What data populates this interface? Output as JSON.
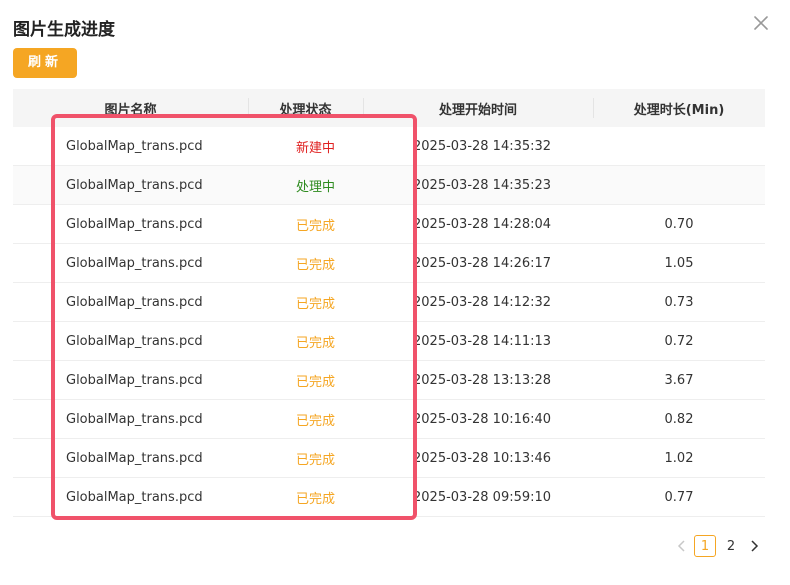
{
  "dialog": {
    "title": "图片生成进度",
    "refresh_label": "刷新"
  },
  "table": {
    "headers": [
      "图片名称",
      "处理状态",
      "处理开始时间",
      "处理时长(Min)"
    ],
    "rows": [
      {
        "name": "GlobalMap_trans.pcd",
        "status": "新建中",
        "start": "2025-03-28 14:35:32",
        "duration": ""
      },
      {
        "name": "GlobalMap_trans.pcd",
        "status": "处理中",
        "start": "2025-03-28 14:35:23",
        "duration": ""
      },
      {
        "name": "GlobalMap_trans.pcd",
        "status": "已完成",
        "start": "2025-03-28 14:28:04",
        "duration": "0.70"
      },
      {
        "name": "GlobalMap_trans.pcd",
        "status": "已完成",
        "start": "2025-03-28 14:26:17",
        "duration": "1.05"
      },
      {
        "name": "GlobalMap_trans.pcd",
        "status": "已完成",
        "start": "2025-03-28 14:12:32",
        "duration": "0.73"
      },
      {
        "name": "GlobalMap_trans.pcd",
        "status": "已完成",
        "start": "2025-03-28 14:11:13",
        "duration": "0.72"
      },
      {
        "name": "GlobalMap_trans.pcd",
        "status": "已完成",
        "start": "2025-03-28 13:13:28",
        "duration": "3.67"
      },
      {
        "name": "GlobalMap_trans.pcd",
        "status": "已完成",
        "start": "2025-03-28 10:16:40",
        "duration": "0.82"
      },
      {
        "name": "GlobalMap_trans.pcd",
        "status": "已完成",
        "start": "2025-03-28 10:13:46",
        "duration": "1.02"
      },
      {
        "name": "GlobalMap_trans.pcd",
        "status": "已完成",
        "start": "2025-03-28 09:59:10",
        "duration": "0.77"
      }
    ]
  },
  "status_colors": {
    "新建中": "#e02020",
    "处理中": "#2e8b1f",
    "已完成": "#f5a623"
  },
  "pagination": {
    "pages": [
      "1",
      "2"
    ],
    "current": "1"
  },
  "icons": {
    "close": "close-icon",
    "prev": "chevron-left-icon",
    "next": "chevron-right-icon"
  },
  "colors": {
    "accent": "#f5a623",
    "highlight": "#f0526a"
  }
}
